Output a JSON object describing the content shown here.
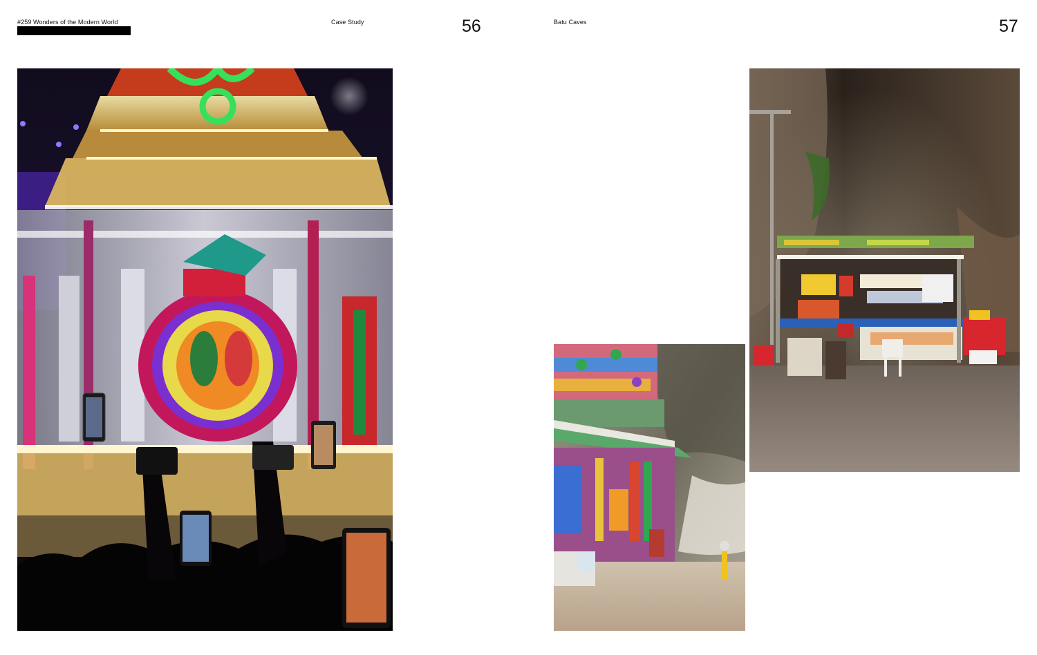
{
  "magazine": {
    "issue_label": "#259 Wonders of the Modern World"
  },
  "left_page": {
    "section_label": "Case Study",
    "page_number": "56",
    "photo": {
      "subject": "Illuminated silver chariot with floral deity shrine, crowd filming with phones",
      "colors": {
        "night": "#0c0a14",
        "gold": "#e8c56a",
        "magenta": "#c2185b",
        "green": "#2fbf4a",
        "purple": "#6a2fd6"
      }
    }
  },
  "right_page": {
    "section_label": "Batu Caves",
    "page_number": "57",
    "photo_small": {
      "subject": "Colorful temple gopuram beside cave rock wall",
      "colors": {
        "rock": "#8e8a7e",
        "floor": "#c9b9a4",
        "temple": "#3b7bd4"
      }
    },
    "photo_large": {
      "subject": "Lit vendor kiosk inside dark cave",
      "colors": {
        "cave": "#2a221c",
        "floor": "#8a7f76",
        "kiosk": "#e9e2cf",
        "red": "#d7262e"
      }
    }
  }
}
